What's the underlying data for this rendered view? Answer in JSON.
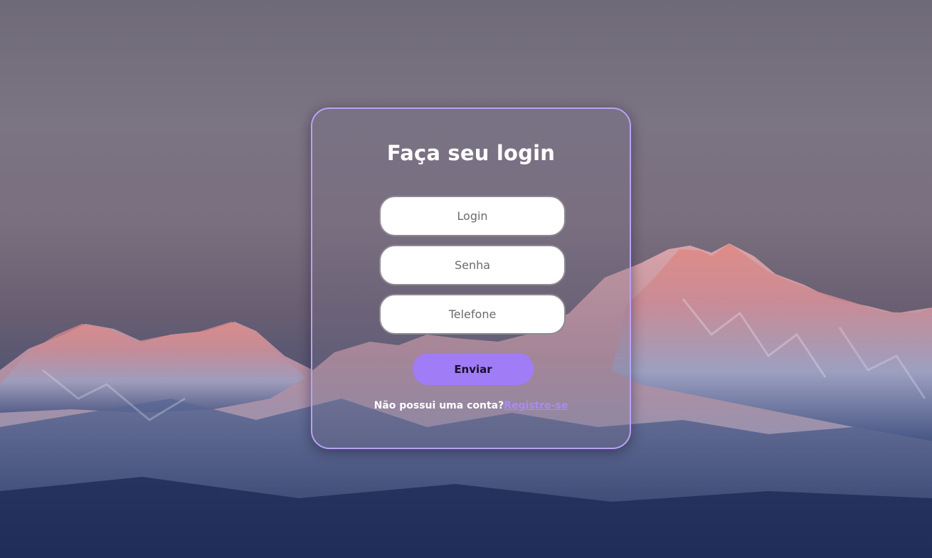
{
  "form": {
    "title": "Faça seu login",
    "login_placeholder": "Login",
    "senha_placeholder": "Senha",
    "telefone_placeholder": "Telefone",
    "submit_label": "Enviar",
    "register_prompt": "Não possui uma conta?",
    "register_link": "Registre-se"
  },
  "colors": {
    "accent": "#a07cf6",
    "card_border": "#b9a2f5",
    "link": "#a98af9"
  }
}
